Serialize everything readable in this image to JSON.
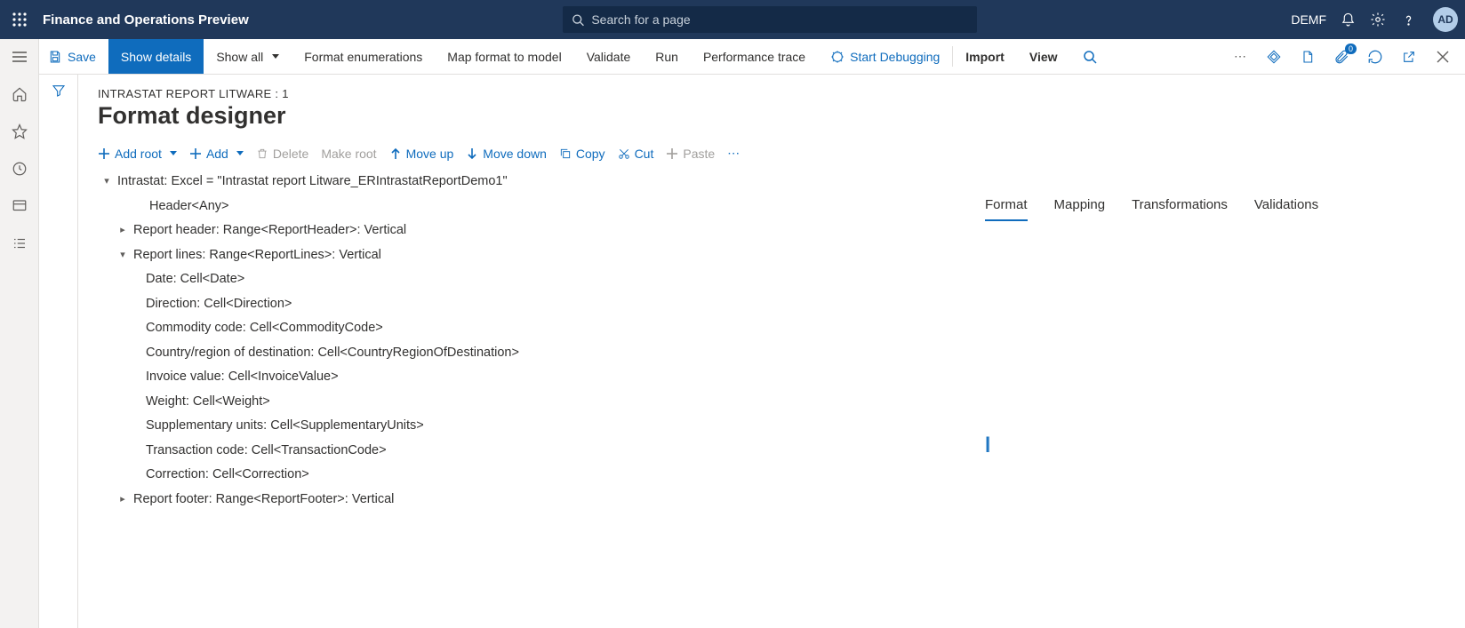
{
  "topbar": {
    "app_title": "Finance and Operations Preview",
    "search_placeholder": "Search for a page",
    "legal_entity": "DEMF",
    "avatar_initials": "AD"
  },
  "actionbar": {
    "save": "Save",
    "show_details": "Show details",
    "show_all": "Show all",
    "format_enum": "Format enumerations",
    "map_format": "Map format to model",
    "validate": "Validate",
    "run": "Run",
    "perf_trace": "Performance trace",
    "start_debug": "Start Debugging",
    "import": "Import",
    "view": "View",
    "attach_badge": "0"
  },
  "page": {
    "breadcrumb": "INTRASTAT REPORT LITWARE : 1",
    "title": "Format designer"
  },
  "tree_tb": {
    "add_root": "Add root",
    "add": "Add",
    "delete": "Delete",
    "make_root": "Make root",
    "move_up": "Move up",
    "move_down": "Move down",
    "copy": "Copy",
    "cut": "Cut",
    "paste": "Paste"
  },
  "tree": {
    "root": "Intrastat: Excel = \"Intrastat report Litware_ERIntrastatReportDemo1\"",
    "header": "Header<Any>",
    "report_header": "Report header: Range<ReportHeader>: Vertical",
    "report_lines": "Report lines: Range<ReportLines>: Vertical",
    "cells": [
      "Date: Cell<Date>",
      "Direction: Cell<Direction>",
      "Commodity code: Cell<CommodityCode>",
      "Country/region of destination: Cell<CountryRegionOfDestination>",
      "Invoice value: Cell<InvoiceValue>",
      "Weight: Cell<Weight>",
      "Supplementary units: Cell<SupplementaryUnits>",
      "Transaction code: Cell<TransactionCode>",
      "Correction: Cell<Correction>"
    ],
    "report_footer": "Report footer: Range<ReportFooter>: Vertical"
  },
  "tabs": {
    "format": "Format",
    "mapping": "Mapping",
    "transformations": "Transformations",
    "validations": "Validations"
  }
}
